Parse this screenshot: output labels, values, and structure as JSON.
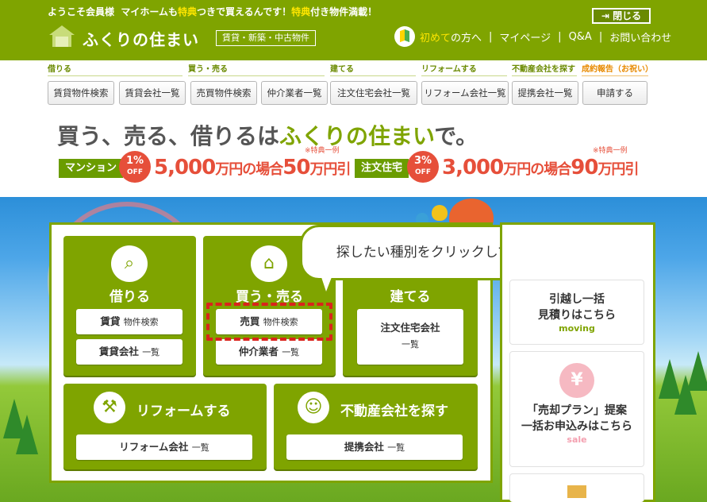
{
  "header": {
    "welcome_prefix": "ようこそ会員様",
    "welcome_msg_a": "マイホームも",
    "welcome_msg_b": "特典",
    "welcome_msg_c": "つきで買えるんです！",
    "welcome_msg_d": "特典",
    "welcome_msg_e": "付き物件満載！",
    "close_label": "閉じる",
    "logo": "ふくりの住まい",
    "logo_tag": "賃貸・新築・中古物件",
    "nav": {
      "beginner_a": "初めて",
      "beginner_b": "の方へ",
      "mypage": "マイページ",
      "qa": "Q&A",
      "contact": "お問い合わせ",
      "sep": "|"
    }
  },
  "categories": [
    {
      "label": "借りる",
      "buttons": [
        "賃貸物件検索",
        "賃貸会社一覧"
      ]
    },
    {
      "label": "買う・売る",
      "buttons": [
        "売買物件検索",
        "仲介業者一覧"
      ]
    },
    {
      "label": "建てる",
      "buttons": [
        "注文住宅会社一覧"
      ]
    },
    {
      "label": "リフォームする",
      "buttons": [
        "リフォーム会社一覧"
      ]
    },
    {
      "label": "不動産会社を探す",
      "buttons": [
        "提携会社一覧"
      ]
    },
    {
      "label": "成約報告（お祝い）",
      "buttons": [
        "申請する"
      ]
    }
  ],
  "promo": {
    "title_a": "買う、売る、借りるは",
    "title_b": "ふくりの住まい",
    "title_c": "で。",
    "left": {
      "tag": "マンション",
      "rate": "1%",
      "off": "OFF",
      "amount_a": "5,000",
      "amount_b": "万円の場合",
      "amount_c": "50",
      "amount_d": "万円引",
      "note": "※特典一例"
    },
    "right": {
      "tag": "注文住宅",
      "rate": "3%",
      "off": "OFF",
      "amount_a": "3,000",
      "amount_b": "万円の場合",
      "amount_c": "90",
      "amount_d": "万円引",
      "note": "※特典一例"
    }
  },
  "callout": "探したい種別をクリックして検索スタート",
  "boxes": {
    "rent": {
      "title": "借りる",
      "btn1_a": "賃貸",
      "btn1_b": "物件検索",
      "btn2_a": "賃貸会社",
      "btn2_b": "一覧"
    },
    "buy": {
      "title": "買う・売る",
      "btn1_a": "売買",
      "btn1_b": "物件検索",
      "btn2_a": "仲介業者",
      "btn2_b": "一覧"
    },
    "build": {
      "title": "建てる",
      "btn1_a": "注文住宅会社",
      "btn1_b": "一覧"
    },
    "reform": {
      "title": "リフォームする",
      "btn1_a": "リフォーム会社",
      "btn1_b": "一覧"
    },
    "agency": {
      "title": "不動産会社を探す",
      "btn1_a": "提携会社",
      "btn1_b": "一覧"
    }
  },
  "side": {
    "moving": {
      "line1": "引越し一括",
      "line2": "見積りはこちら",
      "en": "moving"
    },
    "sale": {
      "line1": "「売却プラン」提案",
      "line2": "一括お申込みはこちら",
      "en": "sale",
      "icon_glyph": "¥"
    }
  },
  "colors": {
    "brand_green": "#7fa400",
    "accent_red": "#e64f3a",
    "highlight": "#d9241c"
  }
}
